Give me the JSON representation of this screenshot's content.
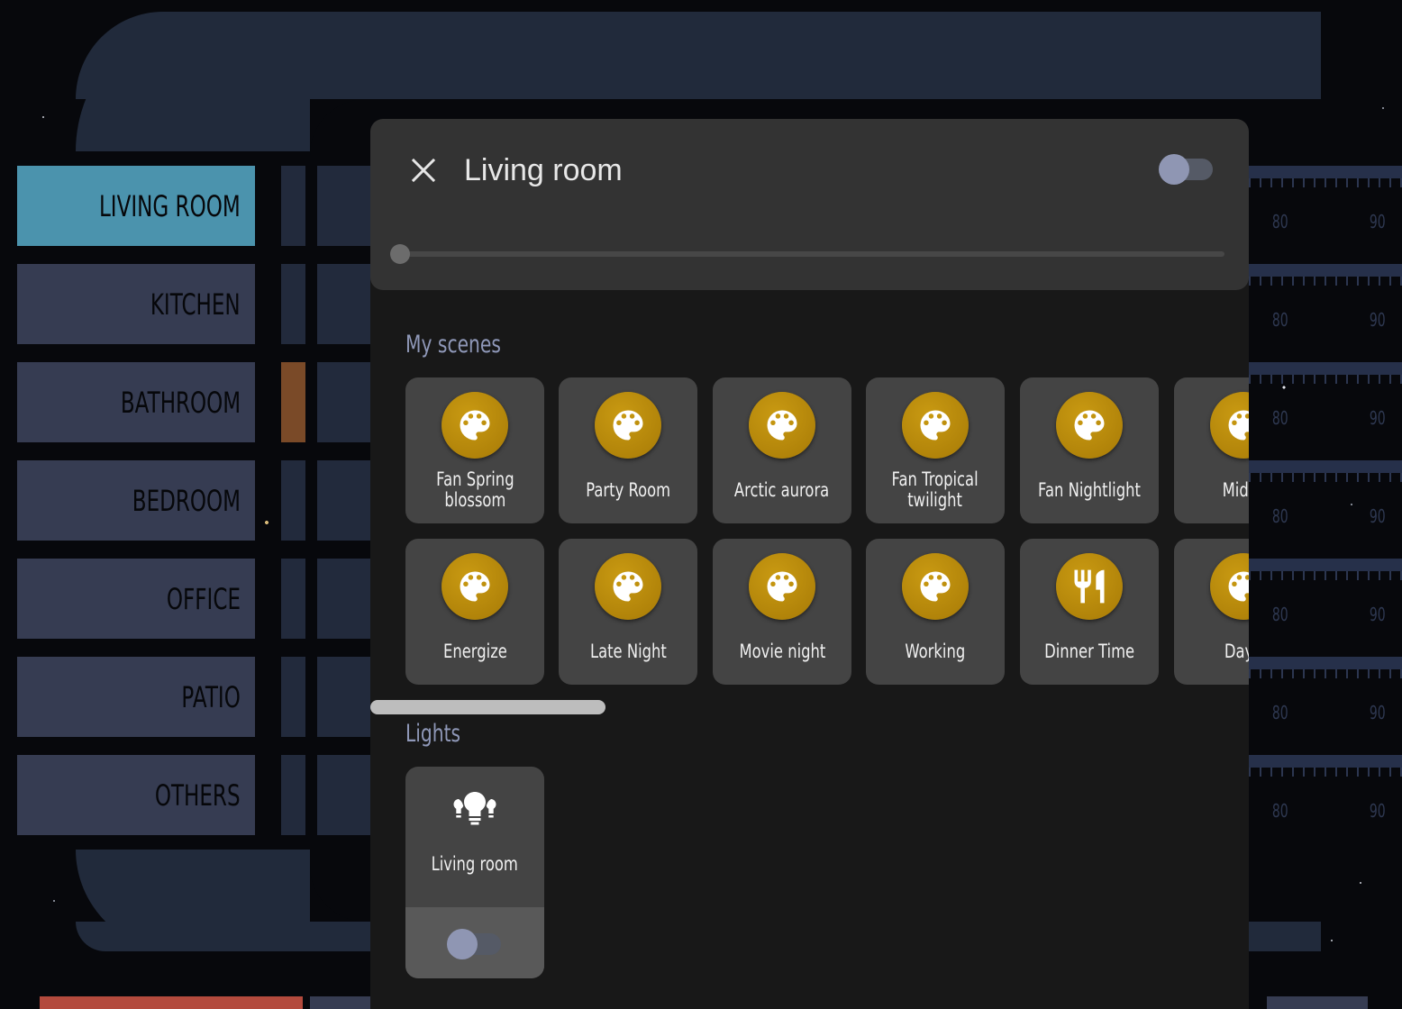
{
  "sidebar": {
    "items": [
      {
        "label": "LIVING ROOM",
        "active": true
      },
      {
        "label": "KITCHEN",
        "active": false
      },
      {
        "label": "BATHROOM",
        "active": false
      },
      {
        "label": "BEDROOM",
        "active": false
      },
      {
        "label": "OFFICE",
        "active": false
      },
      {
        "label": "PATIO",
        "active": false
      },
      {
        "label": "OTHERS",
        "active": false
      }
    ]
  },
  "gauges": {
    "label_a": "80",
    "label_b": "90"
  },
  "dialog": {
    "title": "Living room",
    "power_on": false,
    "brightness": 0
  },
  "scenes": {
    "title": "My scenes",
    "items": [
      {
        "label": "Fan Spring\nblossom",
        "icon": "palette-icon"
      },
      {
        "label": "Party Room",
        "icon": "palette-icon"
      },
      {
        "label": "Arctic aurora",
        "icon": "palette-icon"
      },
      {
        "label": "Fan Tropical\ntwilight",
        "icon": "palette-icon"
      },
      {
        "label": "Fan Nightlight",
        "icon": "palette-icon"
      },
      {
        "label": "Midwi",
        "icon": "palette-icon"
      },
      {
        "label": "Energize",
        "icon": "palette-icon"
      },
      {
        "label": "Late Night",
        "icon": "palette-icon"
      },
      {
        "label": "Movie night",
        "icon": "palette-icon"
      },
      {
        "label": "Working",
        "icon": "palette-icon"
      },
      {
        "label": "Dinner Time",
        "icon": "silverware-icon"
      },
      {
        "label": "Dayli",
        "icon": "palette-icon"
      }
    ]
  },
  "lights": {
    "title": "Lights",
    "items": [
      {
        "label": "Living room",
        "icon": "lightbulb-group-icon",
        "on": false
      }
    ]
  },
  "colors": {
    "accent_blue": "#4b93ad",
    "scene_gold": "#b8880c",
    "frame": "#212a3b",
    "button": "#363c52",
    "alert_red": "#b34a3d"
  }
}
